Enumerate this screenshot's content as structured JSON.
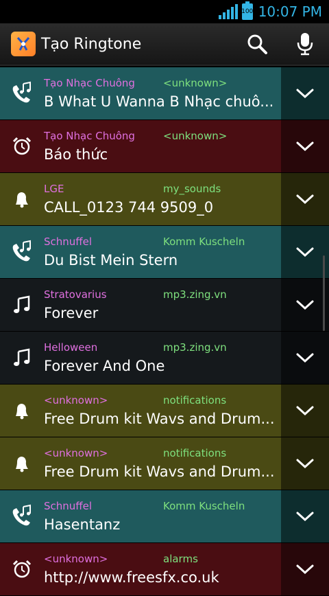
{
  "status": {
    "time": "10:07 PM",
    "battery": "100"
  },
  "app": {
    "title": "Tạo Ringtone"
  },
  "rows": [
    {
      "artist": "Tạo Nhạc Chuông",
      "album": "<unknown>",
      "title": "B What U Wanna B Nhạc chuô...",
      "kind": "ringtone"
    },
    {
      "artist": "Tạo Nhạc Chuông",
      "album": "<unknown>",
      "title": "Báo thức",
      "kind": "alarm"
    },
    {
      "artist": "LGE",
      "album": "my_sounds",
      "title": "CALL_0123 744 9509_0",
      "kind": "notification"
    },
    {
      "artist": "Schnuffel",
      "album": "Komm Kuscheln",
      "title": "Du Bist Mein Stern",
      "kind": "ringtone"
    },
    {
      "artist": "Stratovarius",
      "album": "mp3.zing.vn",
      "title": "Forever",
      "kind": "music"
    },
    {
      "artist": "Helloween",
      "album": "mp3.zing.vn",
      "title": "Forever And One",
      "kind": "music"
    },
    {
      "artist": "<unknown>",
      "album": "notifications",
      "title": "Free Drum kit Wavs and Drum...",
      "kind": "notification"
    },
    {
      "artist": "<unknown>",
      "album": "notifications",
      "title": "Free Drum kit Wavs and Drum...",
      "kind": "notification"
    },
    {
      "artist": "Schnuffel",
      "album": "Komm Kuscheln",
      "title": "Hasentanz",
      "kind": "ringtone"
    },
    {
      "artist": "<unknown>",
      "album": "alarms",
      "title": "http://www.freesfx.co.uk",
      "kind": "alarm"
    }
  ],
  "colors": {
    "ringtone": [
      "#1f5a5d",
      "#0d2d2e"
    ],
    "alarm": [
      "#4a0d12",
      "#28070a"
    ],
    "notification": [
      "#4a4a14",
      "#26260a"
    ],
    "music": [
      "#15191c",
      "#0a0c0e"
    ]
  }
}
